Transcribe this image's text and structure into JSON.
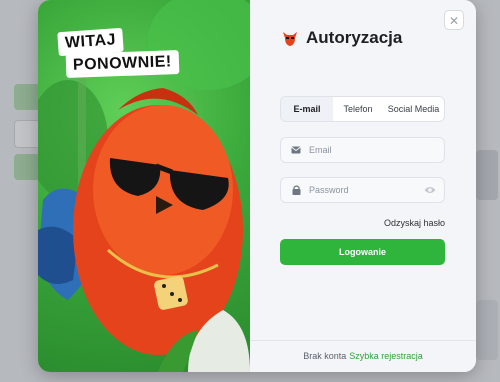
{
  "promo": {
    "headline_line1": "WITAJ",
    "headline_line2": "PONOWNIE!",
    "image": "red-bird-mascot-with-sunglasses"
  },
  "modal": {
    "title": "Autoryzacja",
    "logo_icon": "bird-logo-icon",
    "close_icon": "close-icon"
  },
  "tabs": [
    {
      "label": "E-mail",
      "active": true
    },
    {
      "label": "Telefon",
      "active": false
    },
    {
      "label": "Social Media",
      "active": false
    }
  ],
  "fields": {
    "email": {
      "placeholder": "Email",
      "icon": "envelope-icon",
      "value": ""
    },
    "password": {
      "placeholder": "Password",
      "icon": "lock-icon",
      "value": "",
      "toggle_icon": "eye-icon"
    }
  },
  "forgot_label": "Odzyskaj hasło",
  "login_label": "Logowanie",
  "footer": {
    "text": "Brak konta",
    "register_link": "Szybka rejestracja"
  },
  "colors": {
    "accent": "#2fb53c",
    "link": "#2fa33b",
    "promo_bg": "#3aa83b",
    "panel_bg": "#f3f5f9"
  }
}
